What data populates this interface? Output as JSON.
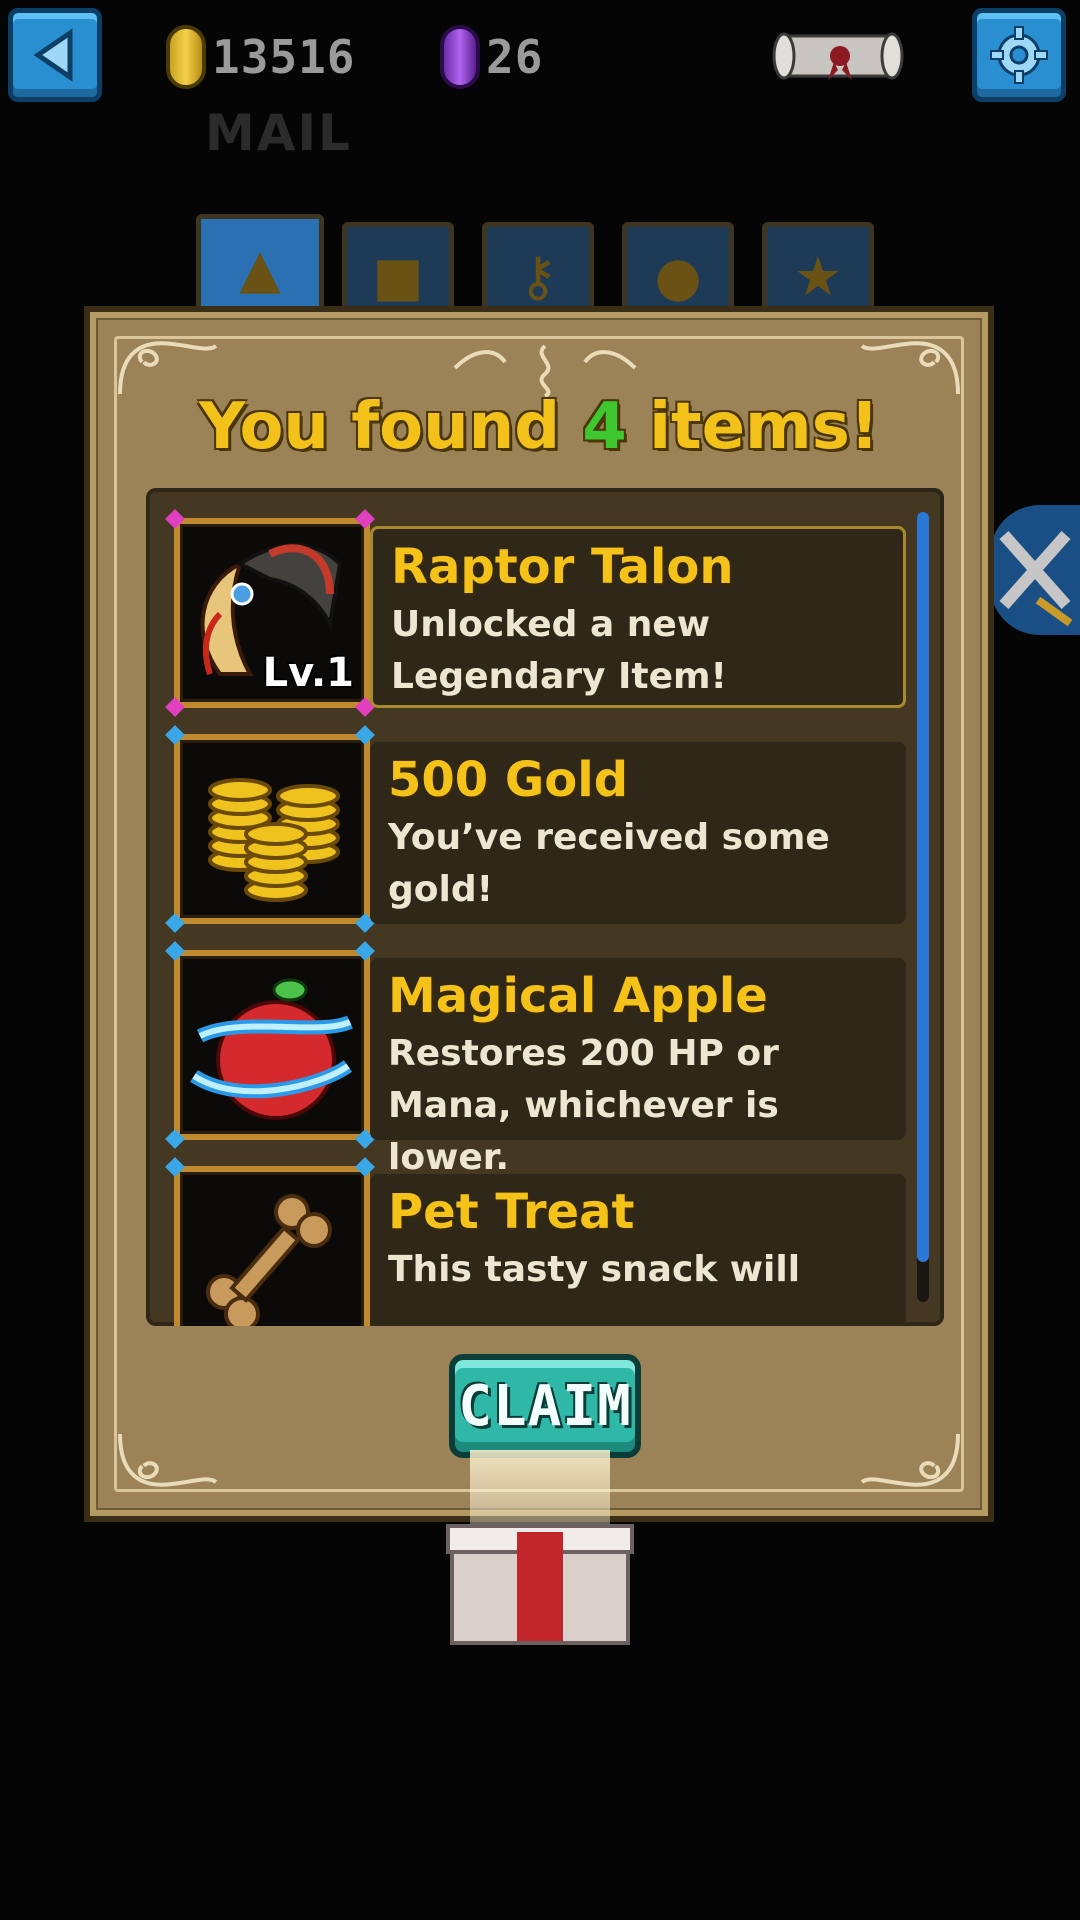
{
  "header": {
    "gold_amount": "13516",
    "gem_amount": "26",
    "section_title": "MAIL"
  },
  "dialog": {
    "title_prefix": "You found ",
    "title_count": "4",
    "title_suffix": " items!",
    "claim_label": "CLAIM"
  },
  "items": [
    {
      "name": "Raptor Talon",
      "description": "Unlocked a new Legendary Item!",
      "badge": "Lv.1",
      "icon": "talon-icon"
    },
    {
      "name": "500 Gold",
      "description": "You’ve received some gold!",
      "icon": "gold-coins-icon"
    },
    {
      "name": "Magical Apple",
      "description": "Restores 200 HP or Mana, whichever is lower.",
      "icon": "apple-icon"
    },
    {
      "name": "Pet Treat",
      "description": "This tasty snack will",
      "icon": "bone-icon"
    }
  ],
  "colors": {
    "title_gold": "#f2c21b",
    "title_count_green": "#3ec72e",
    "dialog_bg": "#9b8257",
    "claim_button": "#2fb8a8",
    "scroll_thumb": "#2b78d8"
  }
}
